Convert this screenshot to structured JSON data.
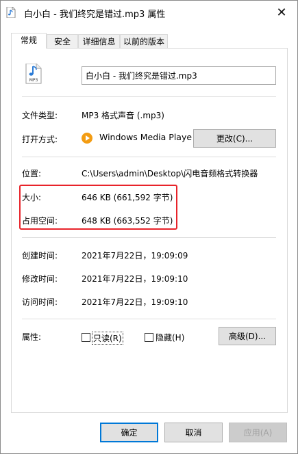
{
  "window": {
    "title": "白小白 - 我们终究是错过.mp3 属性",
    "close_glyph": "✕"
  },
  "tabs": [
    {
      "label": "常规"
    },
    {
      "label": "安全"
    },
    {
      "label": "详细信息"
    },
    {
      "label": "以前的版本"
    }
  ],
  "file": {
    "icon_text": "MP3",
    "name": "白小白 - 我们终究是错过.mp3"
  },
  "type": {
    "label": "文件类型:",
    "value": "MP3 格式声音 (.mp3)"
  },
  "open_with": {
    "label": "打开方式:",
    "app": "Windows Media Playe",
    "change_button": "更改(C)..."
  },
  "location": {
    "label": "位置:",
    "value": "C:\\Users\\admin\\Desktop\\闪电音频格式转换器"
  },
  "size": {
    "label": "大小:",
    "value": "646 KB (661,592 字节)"
  },
  "size_on_disk": {
    "label": "占用空间:",
    "value": "648 KB (663,552 字节)"
  },
  "created": {
    "label": "创建时间:",
    "value": "2021年7月22日，19:09:09"
  },
  "modified": {
    "label": "修改时间:",
    "value": "2021年7月22日，19:09:10"
  },
  "accessed": {
    "label": "访问时间:",
    "value": "2021年7月22日，19:09:10"
  },
  "attributes": {
    "label": "属性:",
    "readonly": "只读(R)",
    "hidden": "隐藏(H)",
    "advanced_button": "高级(D)..."
  },
  "footer": {
    "ok": "确定",
    "cancel": "取消",
    "apply": "应用(A)"
  },
  "colors": {
    "highlight_border": "#e8232a",
    "default_button_border": "#0078d7"
  }
}
